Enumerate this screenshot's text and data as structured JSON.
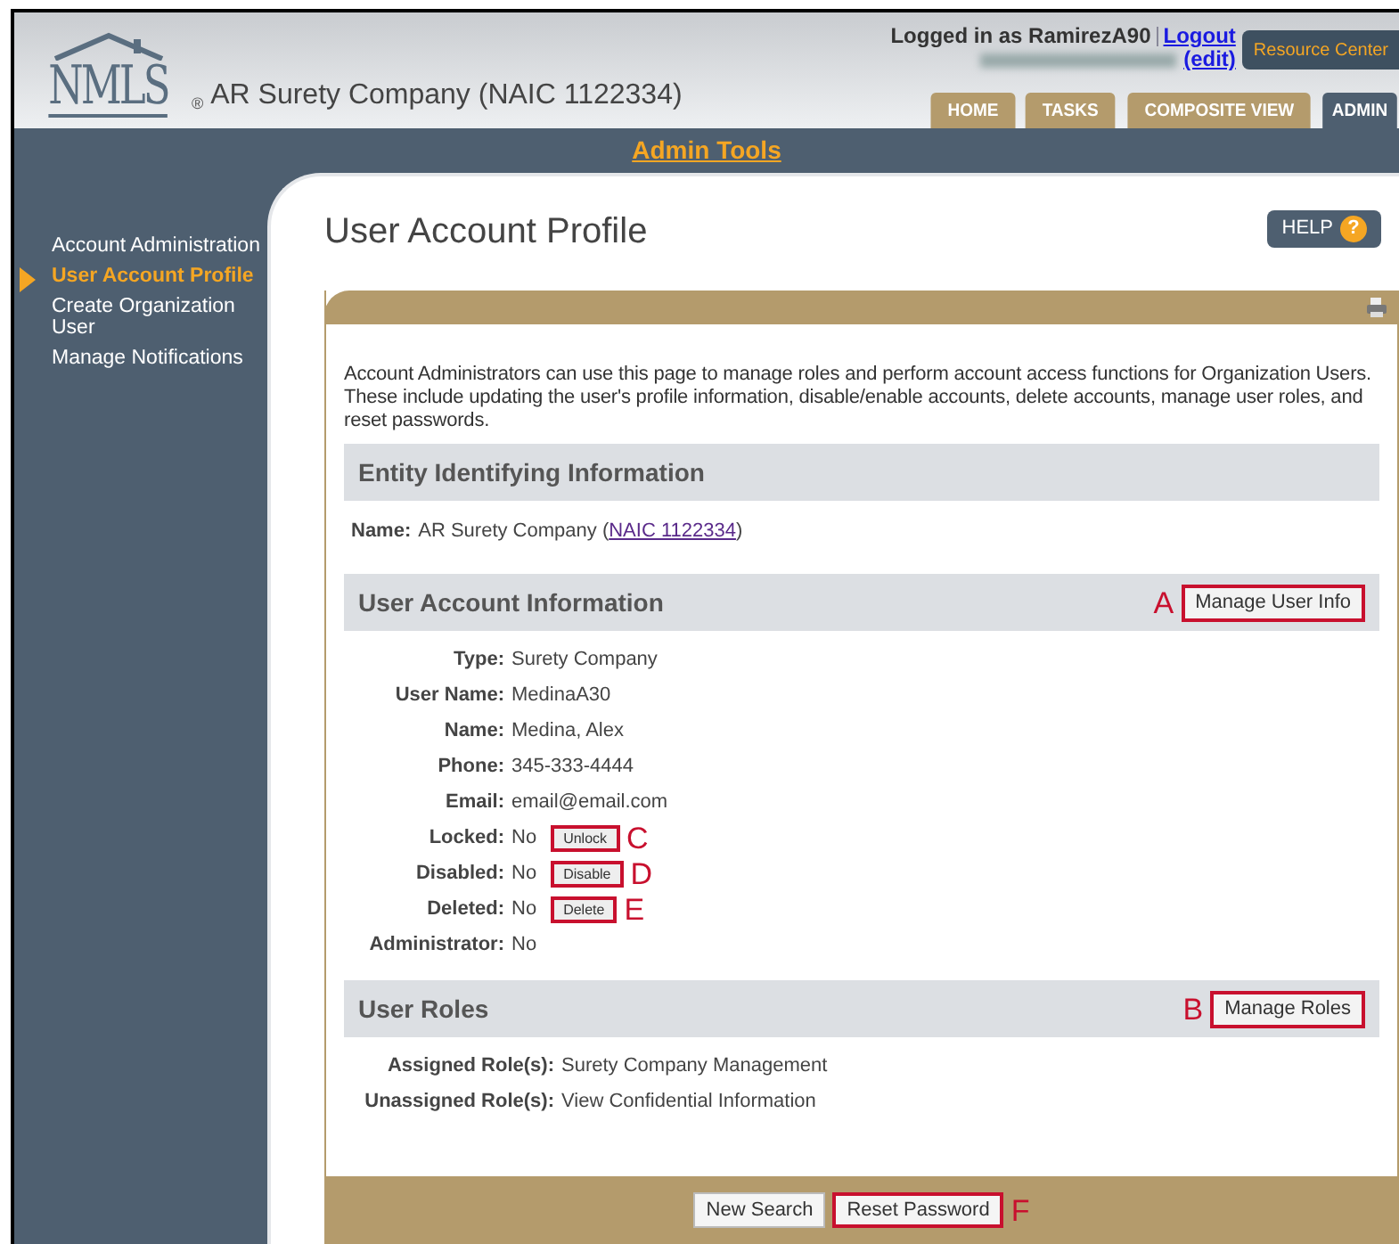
{
  "header": {
    "logo": "NMLS",
    "registered_mark": "®",
    "company": "AR Surety Company (NAIC 1122334)",
    "login_text": "Logged in as RamirezA90",
    "logout": "Logout",
    "edit": "(edit)",
    "resource_center": "Resource Center",
    "tabs": [
      {
        "label": "HOME",
        "selected": false
      },
      {
        "label": "TASKS",
        "selected": false
      },
      {
        "label": "COMPOSITE VIEW",
        "selected": false
      },
      {
        "label": "ADMIN",
        "selected": true
      }
    ]
  },
  "nav_title": "Admin Tools",
  "sidebar": {
    "items": [
      {
        "label": "Account Administration",
        "selected": false
      },
      {
        "label": "User Account Profile",
        "selected": true
      },
      {
        "label": "Create Organization User",
        "selected": false
      },
      {
        "label": "Manage Notifications",
        "selected": false
      }
    ]
  },
  "page": {
    "title": "User Account Profile",
    "help": "HELP",
    "help_mark": "?",
    "intro": "Account Administrators can use this page to manage roles and perform account access functions for Organization Users. These include updating the user's profile information, disable/enable accounts, delete accounts, manage user roles, and reset passwords.",
    "sections": [
      {
        "heading": "Entity Identifying Information",
        "fields": [
          {
            "label": "Name:",
            "value": "AR Surety Company (",
            "link": "NAIC 1122334",
            "suffix": ")"
          }
        ]
      },
      {
        "heading": "User Account Information",
        "button": {
          "label": "Manage User Info",
          "annotation": "A"
        },
        "fields": [
          {
            "label": "Type:",
            "value": "Surety Company"
          },
          {
            "label": "User Name:",
            "value": "MedinaA30"
          },
          {
            "label": "Name:",
            "value": "Medina, Alex"
          },
          {
            "label": "Phone:",
            "value": "345-333-4444"
          },
          {
            "label": "Email:",
            "value": "email@email.com"
          },
          {
            "label": "Locked:",
            "value": "No",
            "button": {
              "label": "Unlock",
              "annotation": "C"
            }
          },
          {
            "label": "Disabled:",
            "value": "No",
            "button": {
              "label": "Disable",
              "annotation": "D"
            }
          },
          {
            "label": "Deleted:",
            "value": "No",
            "button": {
              "label": "Delete",
              "annotation": "E"
            }
          },
          {
            "label": "Administrator:",
            "value": "No"
          }
        ]
      },
      {
        "heading": "User Roles",
        "button": {
          "label": "Manage Roles",
          "annotation": "B"
        },
        "fields": [
          {
            "label": "Assigned Role(s):",
            "value": "Surety Company Management"
          },
          {
            "label": "Unassigned Role(s):",
            "value": "View Confidential Information"
          }
        ]
      }
    ],
    "footer_buttons": [
      {
        "label": "New Search"
      },
      {
        "label": "Reset Password",
        "annotation": "F"
      }
    ]
  }
}
